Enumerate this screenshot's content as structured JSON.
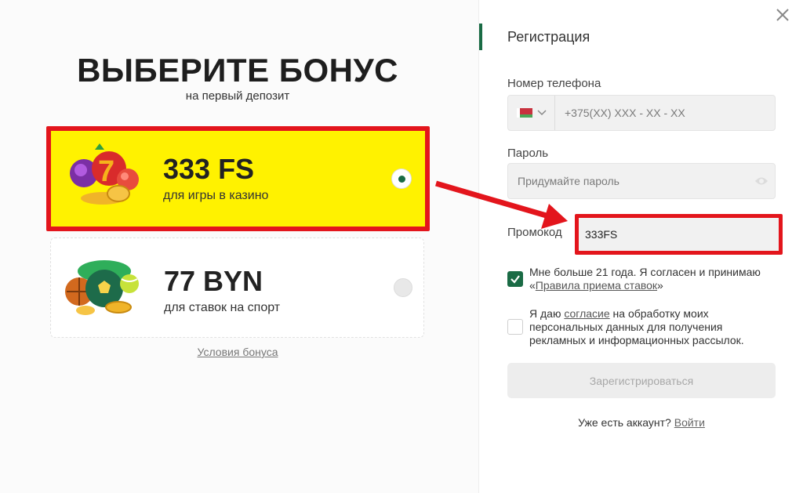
{
  "bonus": {
    "title": "ВЫБЕРИТЕ БОНУС",
    "subtitle": "на первый депозит",
    "cards": [
      {
        "amount": "333 FS",
        "description": "для игры в казино",
        "selected": true,
        "icon": "slot-fruits-icon"
      },
      {
        "amount": "77 BYN",
        "description": "для ставок на спорт",
        "selected": false,
        "icon": "sport-balls-icon"
      }
    ],
    "terms_link": "Условия бонуса"
  },
  "registration": {
    "title": "Регистрация",
    "phone_label": "Номер телефона",
    "phone_placeholder": "+375(XX) XXX - XX - XX",
    "country_flag": "belarus-flag-icon",
    "password_label": "Пароль",
    "password_placeholder": "Придумайте пароль",
    "promo_label": "Промокод",
    "promo_value": "333FS",
    "age_consent": {
      "checked": true,
      "text_before": "Мне больше 21 года. Я согласен и принимаю «",
      "link": "Правила приема ставок",
      "text_after": "»"
    },
    "data_consent": {
      "checked": false,
      "text_before": "Я даю ",
      "link": "согласие",
      "text_after": " на обработку моих персональных данных для получения рекламных и информационных рассылок."
    },
    "submit_label": "Зарегистрироваться",
    "login_prompt": "Уже есть аккаунт?",
    "login_link": "Войти"
  },
  "colors": {
    "accent_green": "#1a6b45",
    "highlight_red": "#e3151c",
    "highlight_yellow": "#fff200"
  }
}
